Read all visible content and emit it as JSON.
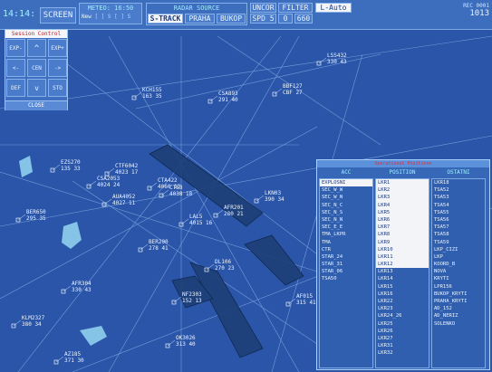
{
  "topbar": {
    "clock": "14:14:",
    "screen_label": "SCREEN",
    "meteo": "METEO: 16:50",
    "meteo_opt_new": "New",
    "meteo_opt_dim": "[ ] S [ ] S",
    "radar_source_label": "RADAR SOURCE",
    "s_track": "S-TRACK",
    "praha": "PRAHA",
    "bukop": "BUKOP",
    "uncor_label": "UNCOR",
    "spd": "SPD 5",
    "filter_label": "FILTER",
    "filter_a": "0",
    "filter_b": "660",
    "l_auto": "L-Auto",
    "right_small": "REC 0001",
    "right_num": "1013"
  },
  "session": {
    "title": "Session Control",
    "exp_minus": "EXP-",
    "up": "^",
    "exp_plus": "EXP+",
    "left": "<-",
    "cen": "CEN",
    "right": "->",
    "def": "DEF",
    "down": "v",
    "sto": "STO",
    "close": "CLOSE"
  },
  "tracks": [
    {
      "callsign": "LSS432",
      "level": "330 43"
    },
    {
      "callsign": "BBF127",
      "level": "CBF 27"
    },
    {
      "callsign": "KCH155",
      "level": "163 35"
    },
    {
      "callsign": "CSA893",
      "level": "291 40"
    },
    {
      "callsign": "EZS270",
      "level": "135 33"
    },
    {
      "callsign": "CTF6042",
      "level": "4023 17"
    },
    {
      "callsign": "CSA2053",
      "level": "4024 24"
    },
    {
      "callsign": "AUA4052",
      "level": "4027 11"
    },
    {
      "callsign": "CTS3",
      "level": "4038 18"
    },
    {
      "callsign": "CTA422",
      "level": "4060 13"
    },
    {
      "callsign": "AFR201",
      "level": "280 21"
    },
    {
      "callsign": "BER650",
      "level": "295 35"
    },
    {
      "callsign": "LKN03",
      "level": "390 34"
    },
    {
      "callsign": "LAL5",
      "level": "4015 16"
    },
    {
      "callsign": "BER200",
      "level": "278 41"
    },
    {
      "callsign": "DL106",
      "level": "270 23"
    },
    {
      "callsign": "AFR304",
      "level": "330 43"
    },
    {
      "callsign": "NF2303",
      "level": "152 13"
    },
    {
      "callsign": "AF015",
      "level": "315 41"
    },
    {
      "callsign": "OK3026",
      "level": "313 40"
    },
    {
      "callsign": "KLM2327",
      "level": "380 34"
    },
    {
      "callsign": "AZ185",
      "level": "371 30"
    }
  ],
  "traffic_list": {
    "title": "Operational Positions",
    "headers": [
      "ACC",
      "POSITION",
      "OSTATNI"
    ],
    "acc": [
      "EXPLOSNI",
      "SEC_W_W",
      "SEC_W_N",
      "SEC_N_C",
      "SEC_N_S",
      "SEC_N_N",
      "SEC_E_E",
      "TMA_LKPR",
      "TMA",
      "CTR",
      "STAR_24",
      "STAR_31",
      "STAR_06",
      "TSA50"
    ],
    "acc_selected": 0,
    "position": [
      "LKR1",
      "LKR2",
      "LKR3",
      "LKR4",
      "LKR5",
      "LKR6",
      "LKR7",
      "LKR8",
      "LKR9",
      "LKR10",
      "LKR11",
      "LKR12",
      "LKR13",
      "LKR14",
      "LKR15",
      "LKR16",
      "LKR22",
      "LKR23",
      "LKR24_26",
      "LKR25",
      "LKR26",
      "LKR27",
      "LKR31",
      "LKR32"
    ],
    "position_selected_count": 12,
    "ostatni": [
      "LKR18",
      "TSA52",
      "TSA53",
      "TSA54",
      "TSA55",
      "TSA56",
      "TSA57",
      "TSA58",
      "TSA59",
      "LKP_CIZI",
      "LKP",
      "KOORD_B",
      "NOVA",
      "KRYTI",
      "LPR156",
      "BUKOP_KRYTI",
      "PRAHA_KRYTI",
      "AD_152",
      "AD_NERIZ",
      "SOLENKO"
    ]
  }
}
